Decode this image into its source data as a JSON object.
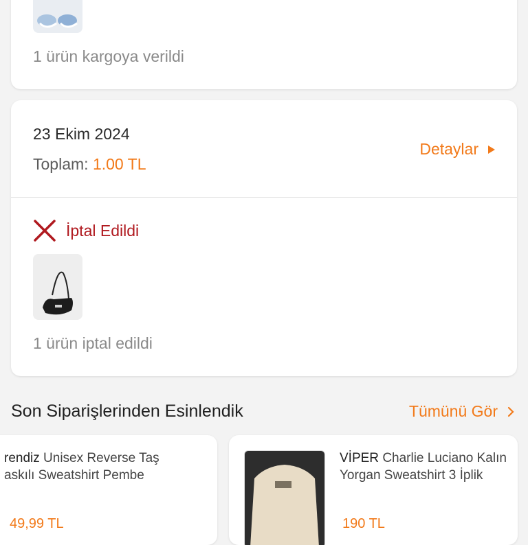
{
  "shipped_card": {
    "summary": "1 ürün kargoya verildi"
  },
  "order": {
    "date": "23 Ekim 2024",
    "total_label": "Toplam:",
    "total_value": "1.00 TL",
    "details_label": "Detaylar",
    "status": "İptal Edildi",
    "summary": "1 ürün iptal edildi"
  },
  "recommend": {
    "title": "Son Siparişlerinden Esinlendik",
    "see_all": "Tümünü Gör",
    "products": [
      {
        "brand": "rendiz",
        "line1": "Unisex Reverse Taş",
        "line2": "askılı Sweatshirt Pembe",
        "price": "49,99 TL"
      },
      {
        "brand": "VİPER",
        "line1": "Charlie Luciano Kalın",
        "line2": "Yorgan Sweatshirt 3 İplik",
        "price": "190 TL"
      }
    ]
  },
  "colors": {
    "accent": "#f27a1a",
    "cancel": "#b0191f",
    "muted": "#8a8a8a"
  }
}
